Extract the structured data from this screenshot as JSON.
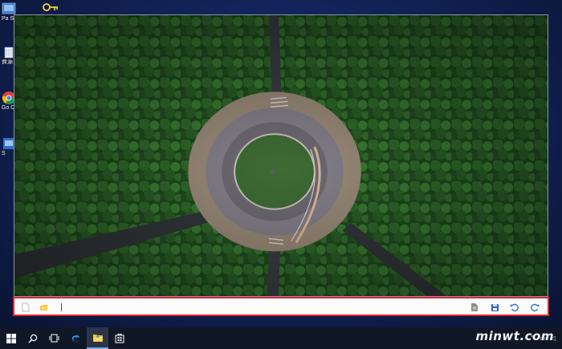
{
  "desktop": {
    "icons": [
      {
        "name": "partial-shortcut",
        "label": "Pa Sh"
      },
      {
        "name": "recycle-bin",
        "label": "資源"
      },
      {
        "name": "google-chrome",
        "label": "Go Ch"
      },
      {
        "name": "shortcut",
        "label": "S"
      }
    ]
  },
  "viewer": {
    "image_subject": "aerial-roundabout-forest"
  },
  "toolbar": {
    "left_buttons": [
      "new-file-icon",
      "open-folder-icon"
    ],
    "right_buttons": [
      "document-icon",
      "save-icon",
      "rotate-left-icon",
      "rotate-right-icon"
    ],
    "highlight_color": "#e0262d"
  },
  "taskbar": {
    "items": [
      "windows-start-icon",
      "search-icon",
      "task-view-icon",
      "edge-icon",
      "file-explorer-icon",
      "store-icon"
    ],
    "active": "file-explorer-icon"
  },
  "watermark": {
    "text": "minwt.com"
  }
}
